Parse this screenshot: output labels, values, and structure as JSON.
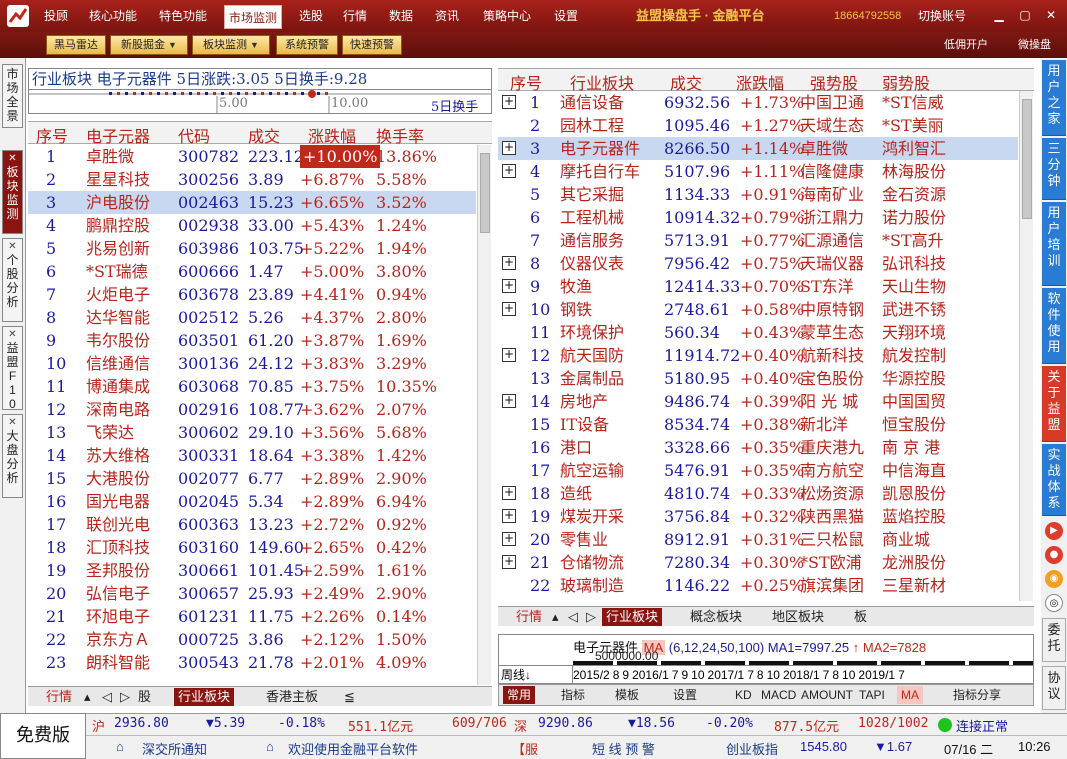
{
  "menu": {
    "items": [
      "投顾",
      "核心功能",
      "特色功能",
      "市场监测",
      "选股",
      "行情",
      "数据",
      "资讯",
      "策略中心",
      "设置"
    ],
    "active": "市场监测",
    "brand": "益盟操盘手 · 金融平台",
    "phone": "18664792558",
    "switch_account": "切换账号"
  },
  "toolbar": {
    "buttons": [
      "黑马雷达",
      "新股掘金",
      "板块监测",
      "系统预警",
      "快速预警"
    ],
    "right_links": [
      "低佣开户",
      "微操盘"
    ]
  },
  "left_tabs": [
    "市场全景",
    "板块监测",
    "个股分析",
    "益盟F10",
    "大盘分析"
  ],
  "right_tabs": [
    "用户之家",
    "三分钟",
    "用户培训",
    "软件使用",
    "关于益盟",
    "实战体系",
    "委托",
    "协议"
  ],
  "left_panel": {
    "header": "行业板块  电子元器件  5日涨跌:3.05  5日换手:9.28",
    "scale_5": "5.00",
    "scale_10": "10.00",
    "scale_label": "5日换手",
    "columns": [
      "序号",
      "电子元器",
      "代码",
      "成交",
      "涨跌幅",
      "换手率"
    ],
    "rows": [
      [
        "1",
        "卓胜微",
        "300782",
        "223.12",
        "+10.00%",
        "13.86%"
      ],
      [
        "2",
        "星星科技",
        "300256",
        "3.89",
        "+6.87%",
        "5.58%"
      ],
      [
        "3",
        "沪电股份",
        "002463",
        "15.23",
        "+6.65%",
        "3.52%"
      ],
      [
        "4",
        "鹏鼎控股",
        "002938",
        "33.00",
        "+5.43%",
        "1.24%"
      ],
      [
        "5",
        "兆易创新",
        "603986",
        "103.75",
        "+5.22%",
        "1.94%"
      ],
      [
        "6",
        "*ST瑞德",
        "600666",
        "1.47",
        "+5.00%",
        "3.80%"
      ],
      [
        "7",
        "火炬电子",
        "603678",
        "23.89",
        "+4.41%",
        "0.94%"
      ],
      [
        "8",
        "达华智能",
        "002512",
        "5.26",
        "+4.37%",
        "2.80%"
      ],
      [
        "9",
        "韦尔股份",
        "603501",
        "61.20",
        "+3.87%",
        "1.69%"
      ],
      [
        "10",
        "信维通信",
        "300136",
        "24.12",
        "+3.83%",
        "3.29%"
      ],
      [
        "11",
        "博通集成",
        "603068",
        "70.85",
        "+3.75%",
        "10.35%"
      ],
      [
        "12",
        "深南电路",
        "002916",
        "108.77",
        "+3.62%",
        "2.07%"
      ],
      [
        "13",
        "飞荣达",
        "300602",
        "29.10",
        "+3.56%",
        "5.68%"
      ],
      [
        "14",
        "苏大维格",
        "300331",
        "18.64",
        "+3.38%",
        "1.42%"
      ],
      [
        "15",
        "大港股份",
        "002077",
        "6.77",
        "+2.89%",
        "2.90%"
      ],
      [
        "16",
        "国光电器",
        "002045",
        "5.34",
        "+2.89%",
        "6.94%"
      ],
      [
        "17",
        "联创光电",
        "600363",
        "13.23",
        "+2.72%",
        "0.92%"
      ],
      [
        "18",
        "汇顶科技",
        "603160",
        "149.60",
        "+2.65%",
        "0.42%"
      ],
      [
        "19",
        "圣邦股份",
        "300661",
        "101.45",
        "+2.59%",
        "1.61%"
      ],
      [
        "20",
        "弘信电子",
        "300657",
        "25.93",
        "+2.49%",
        "2.90%"
      ],
      [
        "21",
        "环旭电子",
        "601231",
        "11.75",
        "+2.26%",
        "0.14%"
      ],
      [
        "22",
        "京东方Ａ",
        "000725",
        "3.86",
        "+2.12%",
        "1.50%"
      ],
      [
        "23",
        "朗科智能",
        "300543",
        "21.78",
        "+2.01%",
        "4.09%"
      ]
    ],
    "selected_row": 2,
    "bottom_tabs": [
      "行情",
      "股",
      "行业板块",
      "香港主板",
      "≦"
    ],
    "bottom_active": "行业板块"
  },
  "right_panel": {
    "columns": [
      "序号",
      "行业板块",
      "成交",
      "涨跌幅",
      "强势股",
      "弱势股"
    ],
    "rows": [
      [
        "1",
        "通信设备",
        "6932.56",
        "+1.73%",
        "中国卫通",
        "*ST信威",
        true
      ],
      [
        "2",
        "园林工程",
        "1095.46",
        "+1.27%",
        "天域生态",
        "*ST美丽",
        false
      ],
      [
        "3",
        "电子元器件",
        "8266.50",
        "+1.14%",
        "卓胜微",
        "鸿利智汇",
        true
      ],
      [
        "4",
        "摩托自行车",
        "5107.96",
        "+1.11%",
        "信隆健康",
        "林海股份",
        true
      ],
      [
        "5",
        "其它采掘",
        "1134.33",
        "+0.91%",
        "海南矿业",
        "金石资源",
        false
      ],
      [
        "6",
        "工程机械",
        "10914.32",
        "+0.79%",
        "浙江鼎力",
        "诺力股份",
        false
      ],
      [
        "7",
        "通信服务",
        "5713.91",
        "+0.77%",
        "汇源通信",
        "*ST高升",
        false
      ],
      [
        "8",
        "仪器仪表",
        "7956.42",
        "+0.75%",
        "天瑞仪器",
        "弘讯科技",
        true
      ],
      [
        "9",
        "牧渔",
        "12414.33",
        "+0.70%",
        "ST东洋",
        "天山生物",
        true
      ],
      [
        "10",
        "钢铁",
        "2748.61",
        "+0.58%",
        "中原特钢",
        "武进不锈",
        true
      ],
      [
        "11",
        "环境保护",
        "560.34",
        "+0.43%",
        "蒙草生态",
        "天翔环境",
        false
      ],
      [
        "12",
        "航天国防",
        "11914.72",
        "+0.40%",
        "航新科技",
        "航发控制",
        true
      ],
      [
        "13",
        "金属制品",
        "5180.95",
        "+0.40%",
        "宝色股份",
        "华源控股",
        false
      ],
      [
        "14",
        "房地产",
        "9486.74",
        "+0.39%",
        "阳 光 城",
        "中国国贸",
        true
      ],
      [
        "15",
        "IT设备",
        "8534.74",
        "+0.38%",
        "新北洋",
        "恒宝股份",
        false
      ],
      [
        "16",
        "港口",
        "3328.66",
        "+0.35%",
        "重庆港九",
        "南 京 港",
        false
      ],
      [
        "17",
        "航空运输",
        "5476.91",
        "+0.35%",
        "南方航空",
        "中信海直",
        false
      ],
      [
        "18",
        "造纸",
        "4810.74",
        "+0.33%",
        "松炀资源",
        "凯恩股份",
        true
      ],
      [
        "19",
        "煤炭开采",
        "3756.84",
        "+0.32%",
        "陕西黑猫",
        "蓝焰控股",
        true
      ],
      [
        "20",
        "零售业",
        "8912.91",
        "+0.31%",
        "三只松鼠",
        "商业城",
        true
      ],
      [
        "21",
        "仓储物流",
        "7280.34",
        "+0.30%",
        "*ST欧浦",
        "龙洲股份",
        true
      ],
      [
        "22",
        "玻璃制造",
        "1146.22",
        "+0.25%",
        "旗滨集团",
        "三星新材",
        false
      ]
    ],
    "selected_row": 2,
    "bottom_tabs": [
      "行情",
      "行业板块",
      "概念板块",
      "地区板块",
      "板"
    ],
    "bottom_active": "行业板块"
  },
  "kline": {
    "name": "电子元器件",
    "indicator": "MA",
    "params": "(6,12,24,50,100)",
    "ma1": "MA1=7997.25",
    "ma2": "MA2=7828",
    "overlay": "5000000.00",
    "period": "周线",
    "dates": [
      "2015/2",
      "8",
      "9",
      "2016/1",
      "7",
      "9",
      "10",
      "2017/1",
      "7",
      "8",
      "10",
      "2018/1",
      "7",
      "8",
      "10",
      "2019/1",
      "7"
    ],
    "tools": [
      "常用",
      "指标",
      "模板",
      "设置",
      "KD",
      "MACD",
      "AMOUNT",
      "TAPI",
      "MA",
      "指标分享"
    ]
  },
  "status": {
    "free": "免费版",
    "sh_label": "沪",
    "sh_index": "2936.80",
    "sh_change": "▼5.39",
    "sh_pct": "-0.18%",
    "sh_amount": "551.1亿元",
    "sh_updown": "609/706",
    "sz_label": "深",
    "sz_index": "9290.86",
    "sz_change": "▼18.56",
    "sz_pct": "-0.20%",
    "sz_amount": "877.5亿元",
    "sz_updown": "1028/1002",
    "conn": "连接正常",
    "notice": "深交所通知",
    "welcome": "欢迎使用金融平台软件",
    "service": "【服",
    "alert": "短 线 预 警",
    "gem_label": "创业板指",
    "gem_index": "1545.80",
    "gem_change": "▼1.67",
    "date": "07/16 二",
    "time": "10:26"
  },
  "colors": {
    "brand_red": "#8a1410",
    "up": "#b8241a",
    "num_blue": "#1a1aa0",
    "header_blue": "#1a3a8a"
  }
}
